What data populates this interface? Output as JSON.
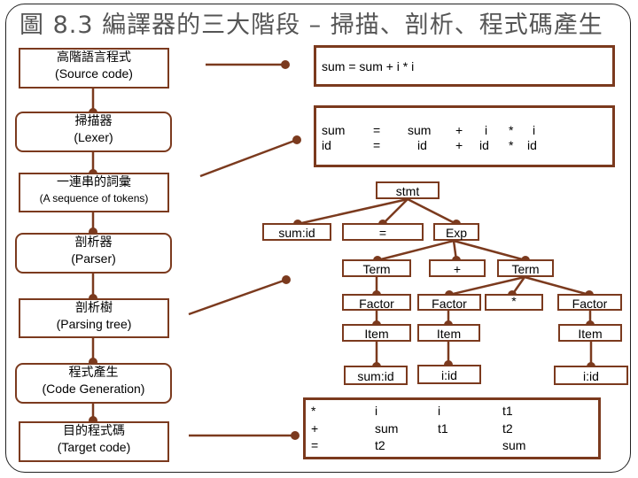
{
  "title": "圖 8.3 編譯器的三大階段 – 掃描、剖析、程式碼產生",
  "colors": {
    "accent": "#7b3a1e",
    "title": "#555555"
  },
  "pipeline": [
    {
      "zh": "高階語言程式",
      "en": "(Source code)"
    },
    {
      "zh": "掃描器",
      "en": "(Lexer)"
    },
    {
      "zh": "一連串的詞彙",
      "en": "(A sequence of tokens)"
    },
    {
      "zh": "剖析器",
      "en": "(Parser)"
    },
    {
      "zh": "剖析樹",
      "en": "(Parsing tree)"
    },
    {
      "zh": "程式產生",
      "en": "(Code Generation)"
    },
    {
      "zh": "目的程式碼",
      "en": "(Target code)"
    }
  ],
  "source_code": "sum = sum + i * i",
  "tokens": {
    "row1": [
      "sum",
      "=",
      "sum",
      "+",
      "i",
      "*",
      "i"
    ],
    "row2": [
      "id",
      "=",
      "id",
      "+",
      "id",
      "*",
      "id"
    ]
  },
  "parse_tree": {
    "stmt": "stmt",
    "sum_id": "sum:id",
    "assign": "=",
    "exp": "Exp",
    "term_left": "Term",
    "plus": "+",
    "term_right": "Term",
    "factor_left": "Factor",
    "factor_mid": "Factor",
    "times": "*",
    "factor_right": "Factor",
    "item_left": "Item",
    "item_mid": "Item",
    "item_right": "Item",
    "leaf_left": "sum:id",
    "leaf_mid": "i:id",
    "leaf_right": "i:id"
  },
  "target_code": [
    [
      "*",
      "i",
      "i",
      "t1"
    ],
    [
      "+",
      "sum",
      "t1",
      "t2"
    ],
    [
      "=",
      "t2",
      "",
      "sum"
    ]
  ]
}
